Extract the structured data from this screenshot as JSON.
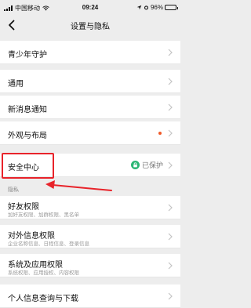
{
  "status_bar": {
    "carrier": "中国移动",
    "time": "09:24",
    "battery_text": "96%",
    "battery_level": 0.96
  },
  "nav": {
    "title": "设置与隐私",
    "back_icon": "chevron-left-icon"
  },
  "rows": {
    "teen_mode": "青少年守护",
    "general": "通用",
    "notifications": "新消息通知",
    "appearance": "外观与布局",
    "security": "安全中心",
    "security_status": "已保护",
    "friend_perms": "好友权限",
    "friend_perms_sub": "加好友权限、加群权限、黑名单",
    "external_info": "对外信息权限",
    "external_info_sub": "企业名称信息、日程信息、登录信息",
    "system_perms": "系统及应用权限",
    "system_perms_sub": "系统权限、应用授权、内容权限",
    "personal_info": "个人信息查询与下载"
  },
  "section": {
    "privacy": "隐私"
  },
  "colors": {
    "highlight": "#e8232a",
    "badge_dot": "#f05a28",
    "protect_green": "#2bb673"
  }
}
